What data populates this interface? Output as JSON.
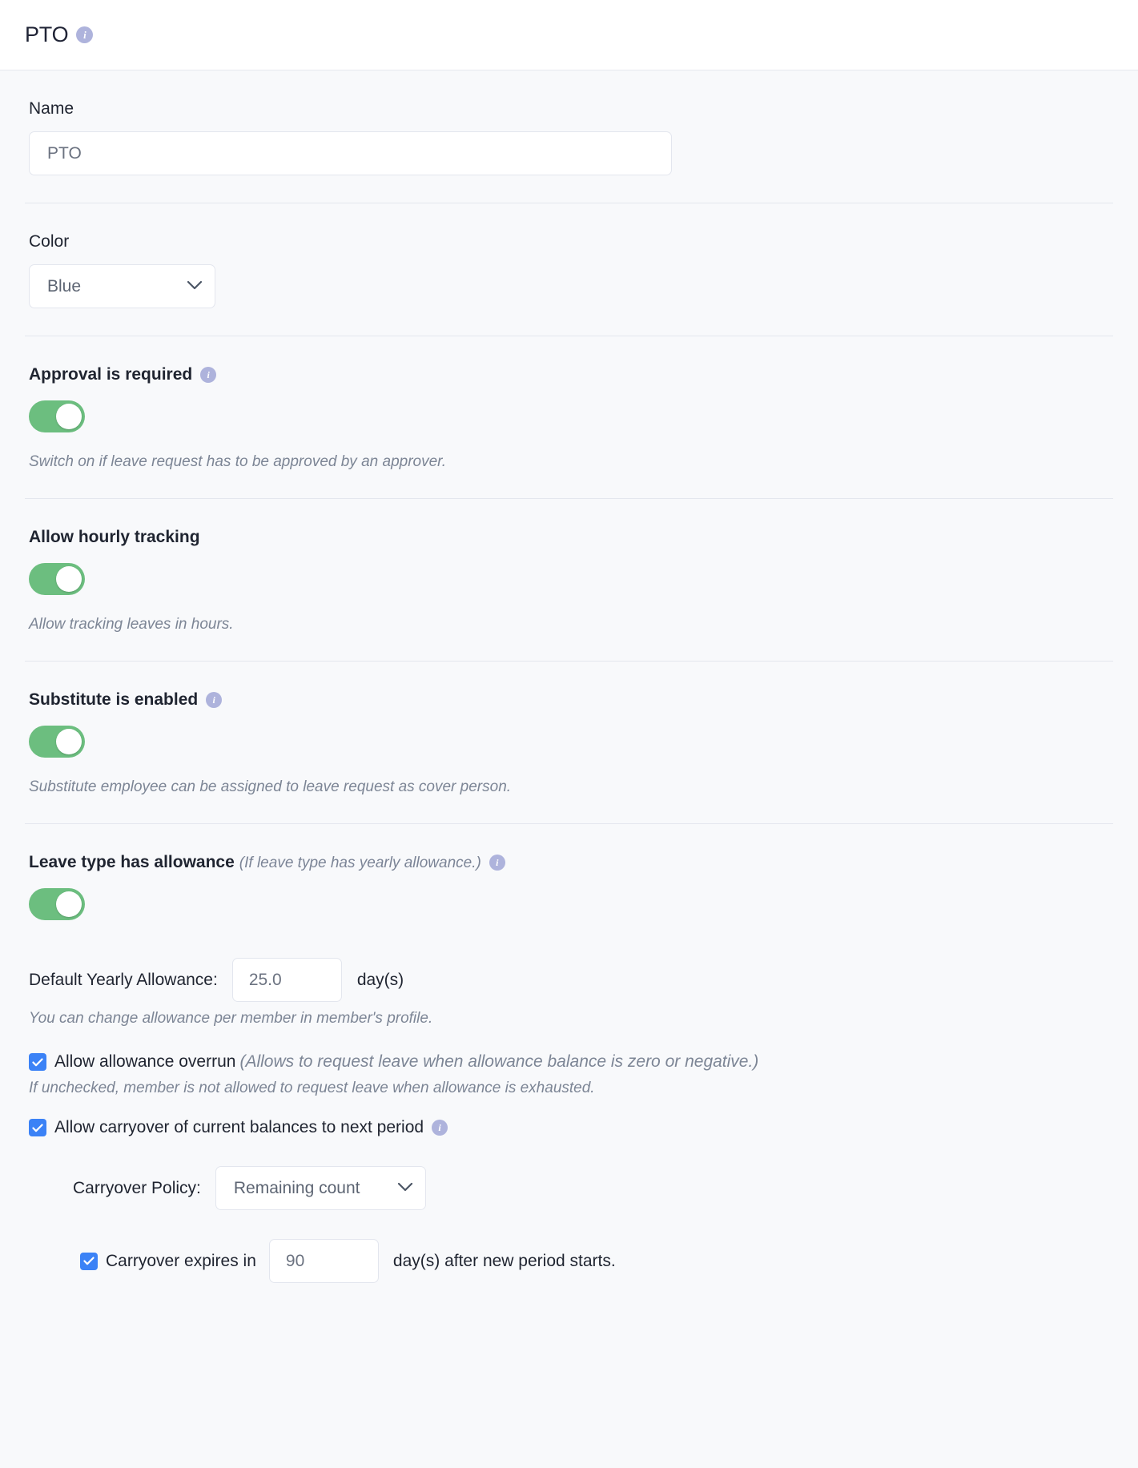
{
  "header": {
    "title": "PTO",
    "info_icon": "info-icon"
  },
  "colors": {
    "toggle_on": "#6cbe7f",
    "checkbox_checked": "#3b82f6",
    "info_badge": "#aeb3dc",
    "page_background": "#f8f9fb",
    "header_background": "#ffffff"
  },
  "name_section": {
    "label": "Name",
    "value": "PTO",
    "placeholder": "PTO"
  },
  "color_section": {
    "label": "Color",
    "selected": "Blue",
    "chevron_icon": "chevron-down-icon"
  },
  "approval_section": {
    "label": "Approval is required",
    "info_icon": "info-icon",
    "toggle_state": "on",
    "hint": "Switch on if leave request has to be approved by an approver."
  },
  "hourly_section": {
    "label": "Allow hourly tracking",
    "toggle_state": "on",
    "hint": "Allow tracking leaves in hours."
  },
  "substitute_section": {
    "label": "Substitute is enabled",
    "info_icon": "info-icon",
    "toggle_state": "on",
    "hint": "Substitute employee can be assigned to leave request as cover person."
  },
  "allowance_section": {
    "label": "Leave type has allowance",
    "label_hint": "(If leave type has yearly allowance.)",
    "info_icon": "info-icon",
    "toggle_state": "on",
    "default_yearly": {
      "label": "Default Yearly Allowance:",
      "value": "25.0",
      "unit": "day(s)",
      "hint": "You can change allowance per member in member's profile."
    },
    "overrun": {
      "checked": true,
      "label": "Allow allowance overrun",
      "label_hint": "(Allows to request leave when allowance balance is zero or negative.)",
      "hint": "If unchecked, member is not allowed to request leave when allowance is exhausted."
    },
    "carryover": {
      "checked": true,
      "label": "Allow carryover of current balances to next period",
      "info_icon": "info-icon",
      "policy": {
        "label": "Carryover Policy:",
        "selected": "Remaining count",
        "chevron_icon": "chevron-down-icon"
      },
      "expires": {
        "checked": true,
        "label": "Carryover expires in",
        "value": "90",
        "tail": "day(s) after new period starts."
      }
    }
  }
}
